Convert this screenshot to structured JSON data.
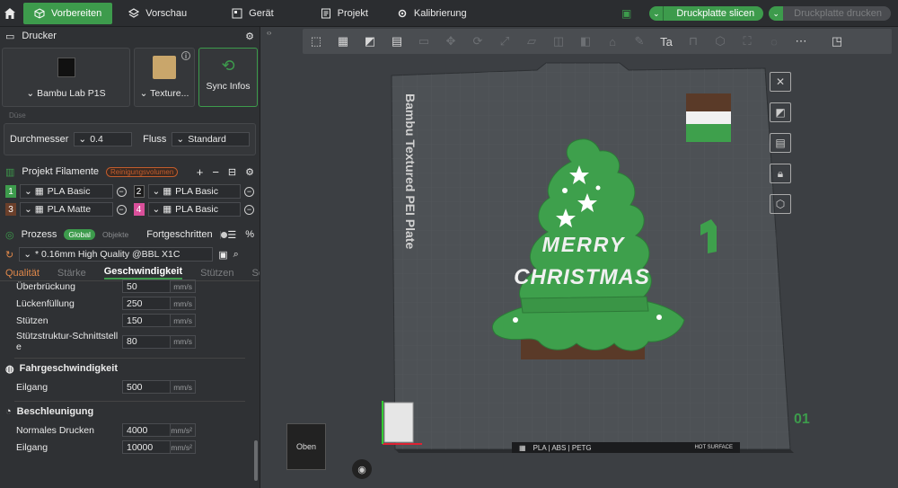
{
  "topbar": {
    "tabs": [
      {
        "label": "Vorbereiten",
        "icon": "cube-icon"
      },
      {
        "label": "Vorschau",
        "icon": "layers-icon"
      },
      {
        "label": "Gerät",
        "icon": "device-icon"
      },
      {
        "label": "Projekt",
        "icon": "document-icon"
      },
      {
        "label": "Kalibrierung",
        "icon": "gear-icon"
      }
    ],
    "slice_label": "Druckplatte slicen",
    "print_label": "Druckplatte drucken"
  },
  "printer": {
    "section_title": "Drucker",
    "printer_name": "Bambu Lab P1S",
    "plate_name": "Texture...",
    "sync_label": "Sync Infos",
    "nozzle_label": "Düse",
    "diameter_label": "Durchmesser",
    "diameter_value": "0.4",
    "flow_label": "Fluss",
    "flow_value": "Standard"
  },
  "filaments": {
    "section_title": "Projekt Filamente",
    "badge": "Reinigungsvolumen",
    "items": [
      {
        "num": "1",
        "name": "PLA Basic",
        "color": "#3d9b4c"
      },
      {
        "num": "2",
        "name": "PLA Basic",
        "color": "#1c1c1c"
      },
      {
        "num": "3",
        "name": "PLA Matte",
        "color": "#6b3f2a"
      },
      {
        "num": "4",
        "name": "PLA Basic",
        "color": "#d94f9a"
      }
    ]
  },
  "process": {
    "section_title": "Prozess",
    "global_label": "Global",
    "objects_label": "Objekte",
    "advanced_label": "Fortgeschritten",
    "profile": "* 0.16mm High Quality @BBL X1C",
    "tabs": [
      "Qualität",
      "Stärke",
      "Geschwindigkeit",
      "Stützen",
      "Sonstige"
    ],
    "params_top": [
      {
        "name": "Überbrückung",
        "value": "50",
        "unit": "mm/s"
      },
      {
        "name": "Lückenfüllung",
        "value": "250",
        "unit": "mm/s"
      },
      {
        "name": "Stützen",
        "value": "150",
        "unit": "mm/s"
      },
      {
        "name": "Stützstruktur-Schnittstelle",
        "value": "80",
        "unit": "mm/s"
      }
    ],
    "travel_title": "Fahrgeschwindigkeit",
    "travel_params": [
      {
        "name": "Eilgang",
        "value": "500",
        "unit": "mm/s"
      }
    ],
    "accel_title": "Beschleunigung",
    "accel_params": [
      {
        "name": "Normales Drucken",
        "value": "4000",
        "unit": "mm/s²"
      },
      {
        "name": "Eilgang",
        "value": "10000",
        "unit": "mm/s²"
      }
    ]
  },
  "viewport": {
    "plate_label": "Bambu Textured PEI Plate",
    "merry": "MERRY",
    "christmas": "CHRISTMAS",
    "plate_number": "01",
    "view_cube": "Oben",
    "strip_text": "PLA | ABS | PETG",
    "hot_surface": "HOT SURFACE"
  }
}
